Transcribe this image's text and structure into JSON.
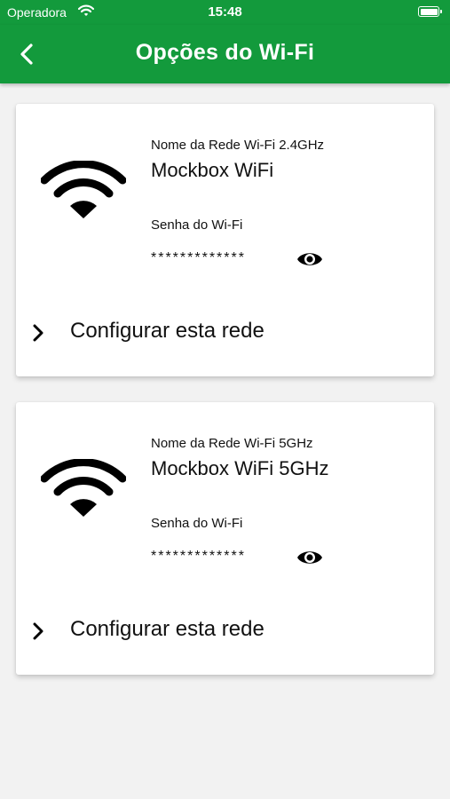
{
  "status_bar": {
    "carrier": "Operadora",
    "time": "15:48"
  },
  "header": {
    "title": "Opções do Wi-Fi",
    "back_icon": "chevron-left-icon"
  },
  "networks": [
    {
      "name_label": "Nome da Rede Wi-Fi 2.4GHz",
      "name": "Mockbox WiFi",
      "password_label": "Senha do Wi-Fi",
      "password_masked": "*************",
      "configure_label": "Configurar esta rede"
    },
    {
      "name_label": "Nome da Rede Wi-Fi 5GHz",
      "name": "Mockbox WiFi 5GHz",
      "password_label": "Senha do Wi-Fi",
      "password_masked": "*************",
      "configure_label": "Configurar esta rede"
    }
  ],
  "colors": {
    "brand_green": "#139a3c",
    "background": "#f2f2f2",
    "card": "#ffffff",
    "text": "#111111"
  }
}
